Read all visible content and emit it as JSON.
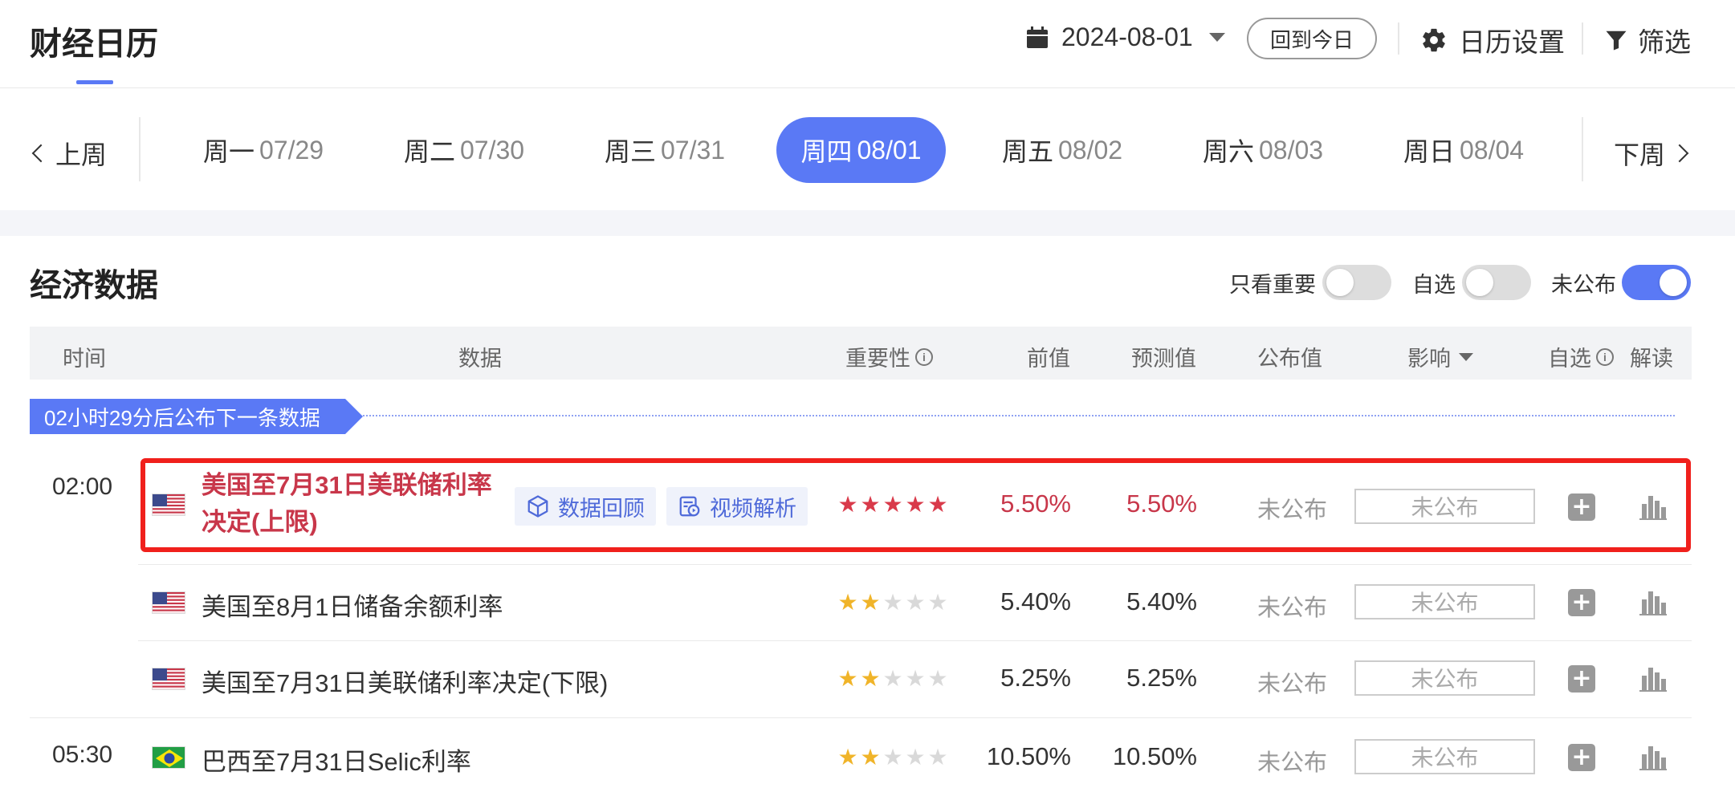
{
  "header": {
    "title": "财经日历",
    "date": "2024-08-01",
    "today_button": "回到今日",
    "settings": "日历设置",
    "filter": "筛选"
  },
  "weeknav": {
    "prev": "上周",
    "next": "下周",
    "days": [
      {
        "name": "周一",
        "date": "07/29",
        "active": false
      },
      {
        "name": "周二",
        "date": "07/30",
        "active": false
      },
      {
        "name": "周三",
        "date": "07/31",
        "active": false
      },
      {
        "name": "周四",
        "date": "08/01",
        "active": true
      },
      {
        "name": "周五",
        "date": "08/02",
        "active": false
      },
      {
        "name": "周六",
        "date": "08/03",
        "active": false
      },
      {
        "name": "周日",
        "date": "08/04",
        "active": false
      }
    ]
  },
  "section": {
    "title": "经济数据",
    "toggles": [
      {
        "label": "只看重要",
        "on": false
      },
      {
        "label": "自选",
        "on": false
      },
      {
        "label": "未公布",
        "on": true
      }
    ]
  },
  "table": {
    "columns": {
      "time": "时间",
      "data": "数据",
      "importance": "重要性",
      "previous": "前值",
      "forecast": "预测值",
      "actual": "公布值",
      "impact": "影响",
      "watchlist": "自选",
      "analysis": "解读"
    },
    "countdown": "02小时29分后公布下一条数据",
    "tags": {
      "review": "数据回顾",
      "video": "视频解析"
    },
    "rows": [
      {
        "time": "02:00",
        "country": "us",
        "event": "美国至7月31日美联储利率决定(上限)",
        "stars": 5,
        "previous": "5.50%",
        "forecast": "5.50%",
        "actual": "未公布",
        "impact": "未公布",
        "highlight": true
      },
      {
        "time": "",
        "country": "us",
        "event": "美国至8月1日储备余额利率",
        "stars": 2,
        "previous": "5.40%",
        "forecast": "5.40%",
        "actual": "未公布",
        "impact": "未公布",
        "highlight": false
      },
      {
        "time": "",
        "country": "us",
        "event": "美国至7月31日美联储利率决定(下限)",
        "stars": 2,
        "previous": "5.25%",
        "forecast": "5.25%",
        "actual": "未公布",
        "impact": "未公布",
        "highlight": false
      },
      {
        "time": "05:30",
        "country": "br",
        "event": "巴西至7月31日Selic利率",
        "stars": 2,
        "previous": "10.50%",
        "forecast": "10.50%",
        "actual": "未公布",
        "impact": "未公布",
        "highlight": false
      }
    ]
  },
  "colors": {
    "accent": "#5a79f5",
    "highlight_red": "#c8374a",
    "star_red": "#d93a4a",
    "star_gold": "#f0b429",
    "star_gray": "#d9d9d9"
  }
}
